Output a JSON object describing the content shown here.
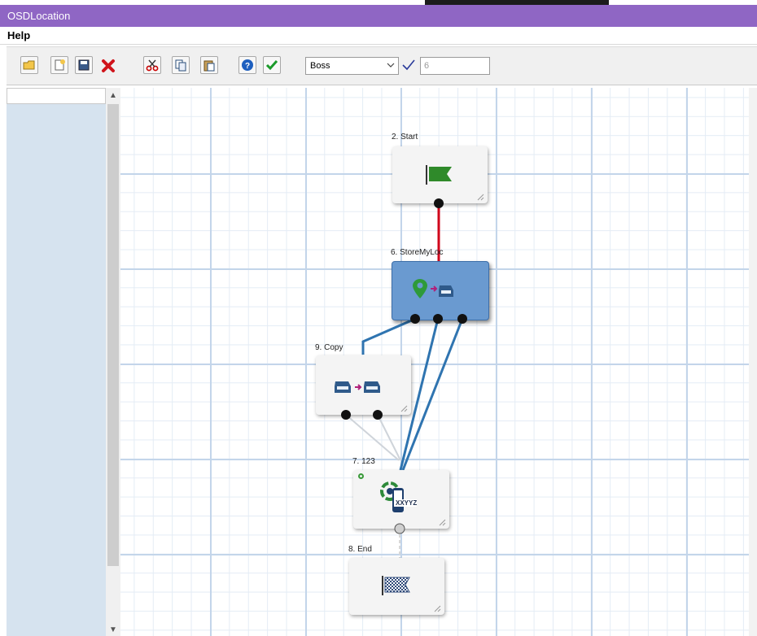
{
  "window": {
    "title": "OSDLocation"
  },
  "menu": {
    "items": [
      {
        "label": "Help"
      }
    ]
  },
  "toolbar": {
    "buttons": [
      "open-icon",
      "new-icon",
      "save-icon",
      "delete-icon",
      "cut-icon",
      "copy-icon",
      "paste-icon",
      "help-icon",
      "check-icon"
    ],
    "user_select": "Boss",
    "field_value": "6"
  },
  "diagram": {
    "nodes": [
      {
        "label": "2. Start",
        "icon": "start-flag-icon"
      },
      {
        "label": "6. StoreMyLoc",
        "icon": "store-location-icon"
      },
      {
        "label": "9. Copy",
        "icon": "copy-mailbox-icon"
      },
      {
        "label": "7. 123",
        "icon": "phone-api-icon",
        "badge": "XXYYZ"
      },
      {
        "label": "8. End",
        "icon": "end-flag-icon"
      }
    ]
  },
  "colors": {
    "titlebar": "#8f66c4",
    "link_red": "#d0021b",
    "link_blue": "#2f74b0",
    "selected_node": "#6a9ad0"
  }
}
